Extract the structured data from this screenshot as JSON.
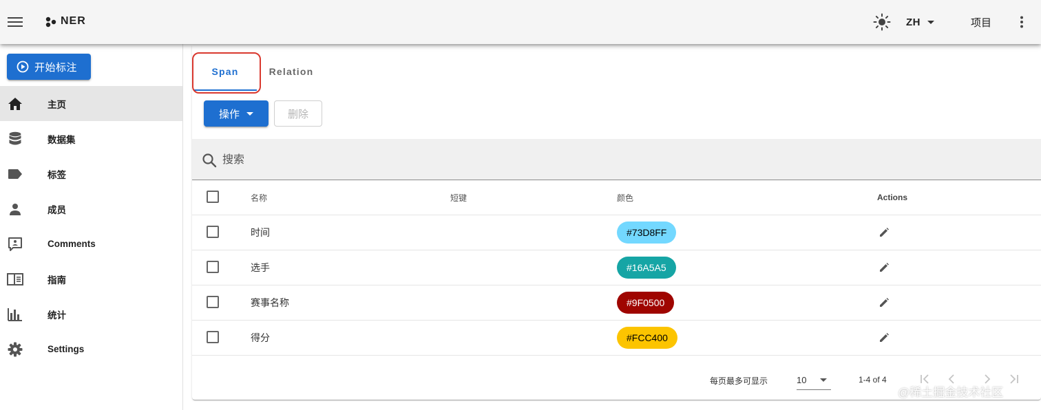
{
  "appbar": {
    "title": "NER",
    "lang": "ZH",
    "projects_label": "项目",
    "icons": [
      "menu-icon",
      "logo-icon",
      "theme-sun-icon",
      "more-vert-icon"
    ]
  },
  "sidebar": {
    "start_label": "开始标注",
    "items": [
      {
        "label": "主页",
        "icon": "home-icon",
        "active": true
      },
      {
        "label": "数据集",
        "icon": "database-icon"
      },
      {
        "label": "标签",
        "icon": "label-icon"
      },
      {
        "label": "成员",
        "icon": "person-icon"
      },
      {
        "label": "Comments",
        "icon": "comment-icon"
      },
      {
        "label": "指南",
        "icon": "book-icon"
      },
      {
        "label": "统计",
        "icon": "chart-icon"
      },
      {
        "label": "Settings",
        "icon": "gear-icon"
      }
    ]
  },
  "tabs": [
    {
      "label": "Span",
      "active": true
    },
    {
      "label": "Relation",
      "active": false
    }
  ],
  "toolbar": {
    "actions_label": "操作",
    "delete_label": "删除"
  },
  "search": {
    "placeholder": "搜索"
  },
  "table": {
    "headers": {
      "name": "名称",
      "shortcut": "短键",
      "color": "颜色",
      "actions": "Actions"
    },
    "rows": [
      {
        "name": "时间",
        "shortcut": "",
        "color": "#73D8FF",
        "text_color": "#000000"
      },
      {
        "name": "选手",
        "shortcut": "",
        "color": "#16A5A5",
        "text_color": "#ffffff"
      },
      {
        "name": "赛事名称",
        "shortcut": "",
        "color": "#9F0500",
        "text_color": "#ffffff"
      },
      {
        "name": "得分",
        "shortcut": "",
        "color": "#FCC400",
        "text_color": "#000000"
      }
    ]
  },
  "footer": {
    "rows_per_page_label": "每页最多可显示",
    "rows_per_page": "10",
    "range": "1-4 of 4"
  },
  "watermark": "@稀土掘金技术社区",
  "colors": {
    "primary": "#1e6fd0",
    "highlight": "#d9382e"
  }
}
